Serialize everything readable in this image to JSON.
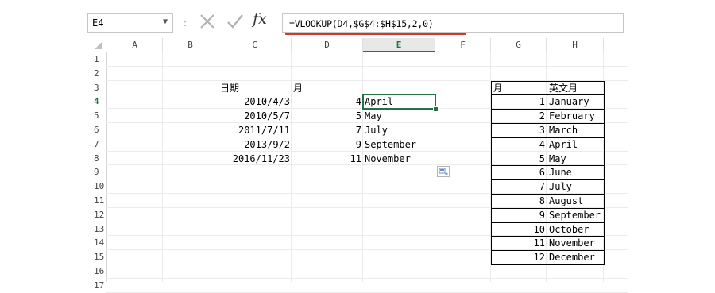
{
  "name_box": {
    "value": "E4",
    "dropdown_icon": "triangle-down"
  },
  "formula_bar": {
    "separator": ":",
    "cancel_icon": "x-mark",
    "enter_icon": "check-mark",
    "fx_label": "fx",
    "formula": "=VLOOKUP(D4,$G$4:$H$15,2,0)",
    "highlight_color": "#d9342b"
  },
  "sheet": {
    "active_cell": "E4",
    "active_column": "E",
    "active_row": "4",
    "accent_color": "#217346",
    "columns": [
      "A",
      "B",
      "C",
      "D",
      "E",
      "F",
      "G",
      "H"
    ],
    "rows": [
      "1",
      "2",
      "3",
      "4",
      "5",
      "6",
      "7",
      "8",
      "9",
      "10",
      "11",
      "12",
      "13",
      "14",
      "15",
      "16",
      "17"
    ],
    "cells": {
      "C3": "日期",
      "D3": "月",
      "G3": "月",
      "H3": "英文月",
      "C4": "2010/4/3",
      "D4": "4",
      "E4": "April",
      "C5": "2010/5/7",
      "D5": "5",
      "E5": "May",
      "C6": "2011/7/11",
      "D6": "7",
      "E6": "July",
      "C7": "2013/9/2",
      "D7": "9",
      "E7": "September",
      "C8": "2016/11/23",
      "D8": "11",
      "E8": "November",
      "G4": "1",
      "H4": "January",
      "G5": "2",
      "H5": "February",
      "G6": "3",
      "H6": "March",
      "G7": "4",
      "H7": "April",
      "G8": "5",
      "H8": "May",
      "G9": "6",
      "H9": "June",
      "G10": "7",
      "H10": "July",
      "G11": "8",
      "H11": "August",
      "G12": "9",
      "H12": "September",
      "G13": "10",
      "H13": "October",
      "G14": "11",
      "H14": "November",
      "G15": "12",
      "H15": "December"
    },
    "numeric_cells": [
      "C4",
      "C5",
      "C6",
      "C7",
      "C8",
      "D4",
      "D5",
      "D6",
      "D7",
      "D8",
      "G4",
      "G5",
      "G6",
      "G7",
      "G8",
      "G9",
      "G10",
      "G11",
      "G12",
      "G13",
      "G14",
      "G15"
    ],
    "bordered_range": "G3:H15",
    "autofill_options_icon": "paste-options-icon"
  }
}
